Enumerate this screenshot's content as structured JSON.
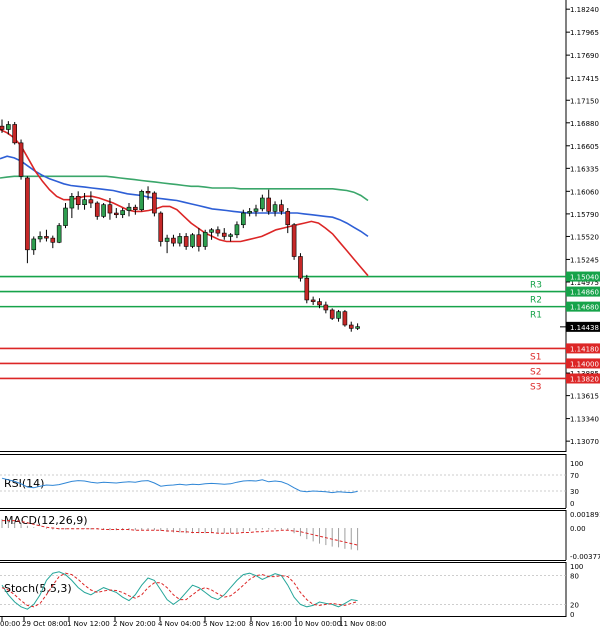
{
  "chart_data": [
    {
      "type": "candlestick",
      "title": "",
      "ylim": [
        1.13,
        1.1829
      ],
      "y_ticks": [
        "1.18240",
        "1.17965",
        "1.17690",
        "1.17415",
        "1.17150",
        "1.16880",
        "1.16605",
        "1.16335",
        "1.16060",
        "1.15790",
        "1.15520",
        "1.15245",
        "1.14975",
        "1.14705",
        "1.14435",
        "1.14160",
        "1.13885",
        "1.13615",
        "1.13340",
        "1.13070"
      ],
      "current_price": "1.14438",
      "candles": [
        [
          1.1684,
          1.1692,
          1.1676,
          1.168
        ],
        [
          1.168,
          1.169,
          1.1674,
          1.1686
        ],
        [
          1.1686,
          1.1689,
          1.1662,
          1.1664
        ],
        [
          1.1664,
          1.1668,
          1.162,
          1.1624
        ],
        [
          1.1622,
          1.1624,
          1.152,
          1.1536
        ],
        [
          1.1536,
          1.1552,
          1.153,
          1.1549
        ],
        [
          1.1549,
          1.1558,
          1.1545,
          1.1552
        ],
        [
          1.1552,
          1.156,
          1.1546,
          1.155
        ],
        [
          1.155,
          1.1553,
          1.1538,
          1.1545
        ],
        [
          1.1545,
          1.1568,
          1.1544,
          1.1565
        ],
        [
          1.1565,
          1.1592,
          1.1562,
          1.1586
        ],
        [
          1.1586,
          1.1604,
          1.1574,
          1.16
        ],
        [
          1.16,
          1.1606,
          1.1584,
          1.159
        ],
        [
          1.159,
          1.1604,
          1.1584,
          1.1596
        ],
        [
          1.1596,
          1.1606,
          1.1586,
          1.1592
        ],
        [
          1.1592,
          1.1594,
          1.1572,
          1.1576
        ],
        [
          1.1576,
          1.1592,
          1.1574,
          1.159
        ],
        [
          1.159,
          1.1598,
          1.1572,
          1.158
        ],
        [
          1.158,
          1.1586,
          1.1574,
          1.1578
        ],
        [
          1.1578,
          1.1586,
          1.1574,
          1.1583
        ],
        [
          1.1583,
          1.1592,
          1.1576,
          1.1587
        ],
        [
          1.1587,
          1.159,
          1.1578,
          1.1584
        ],
        [
          1.1584,
          1.1608,
          1.1582,
          1.1606
        ],
        [
          1.1606,
          1.1612,
          1.1596,
          1.1604
        ],
        [
          1.1604,
          1.1606,
          1.1576,
          1.158
        ],
        [
          1.158,
          1.1582,
          1.154,
          1.1546
        ],
        [
          1.1546,
          1.1554,
          1.1532,
          1.155
        ],
        [
          1.155,
          1.1554,
          1.154,
          1.1544
        ],
        [
          1.1544,
          1.1556,
          1.154,
          1.1552
        ],
        [
          1.1552,
          1.1556,
          1.1536,
          1.154
        ],
        [
          1.154,
          1.1556,
          1.1538,
          1.1554
        ],
        [
          1.1554,
          1.1562,
          1.1534,
          1.154
        ],
        [
          1.154,
          1.156,
          1.1536,
          1.1557
        ],
        [
          1.1557,
          1.1562,
          1.1548,
          1.156
        ],
        [
          1.156,
          1.1564,
          1.1552,
          1.1556
        ],
        [
          1.1556,
          1.1562,
          1.1548,
          1.1552
        ],
        [
          1.1552,
          1.1556,
          1.1546,
          1.1554
        ],
        [
          1.1554,
          1.157,
          1.155,
          1.1566
        ],
        [
          1.1566,
          1.1584,
          1.1562,
          1.158
        ],
        [
          1.158,
          1.1586,
          1.1576,
          1.1582
        ],
        [
          1.1582,
          1.159,
          1.1576,
          1.1585
        ],
        [
          1.1585,
          1.1602,
          1.1582,
          1.1598
        ],
        [
          1.1598,
          1.1608,
          1.1578,
          1.1582
        ],
        [
          1.1582,
          1.1594,
          1.1576,
          1.159
        ],
        [
          1.159,
          1.1596,
          1.1578,
          1.1582
        ],
        [
          1.1582,
          1.1586,
          1.1556,
          1.1566
        ],
        [
          1.1566,
          1.1568,
          1.1524,
          1.1528
        ],
        [
          1.1528,
          1.1532,
          1.1498,
          1.1502
        ],
        [
          1.1502,
          1.1506,
          1.1472,
          1.1476
        ],
        [
          1.1476,
          1.148,
          1.147,
          1.1474
        ],
        [
          1.1474,
          1.1478,
          1.1466,
          1.147
        ],
        [
          1.147,
          1.1474,
          1.146,
          1.1464
        ],
        [
          1.1464,
          1.1466,
          1.1452,
          1.1454
        ],
        [
          1.1454,
          1.1464,
          1.145,
          1.1462
        ],
        [
          1.1462,
          1.1464,
          1.1444,
          1.1446
        ],
        [
          1.1446,
          1.145,
          1.1438,
          1.1442
        ],
        [
          1.1442,
          1.1448,
          1.144,
          1.1444
        ]
      ],
      "ma_fast": [
        1.168,
        1.1676,
        1.167,
        1.166,
        1.1645,
        1.163,
        1.1618,
        1.1608,
        1.16,
        1.1596,
        1.1596,
        1.1598,
        1.16,
        1.16,
        1.1598,
        1.1595,
        1.1592,
        1.1588,
        1.1584,
        1.1582,
        1.1582,
        1.1583,
        1.1585,
        1.1588,
        1.1588,
        1.1584,
        1.1576,
        1.1568,
        1.1562,
        1.1556,
        1.1552,
        1.1548,
        1.1546,
        1.1546,
        1.1546,
        1.1548,
        1.155,
        1.1552,
        1.1556,
        1.156,
        1.1562,
        1.1564,
        1.1566,
        1.1568,
        1.157,
        1.1568,
        1.1562,
        1.1555,
        1.1545,
        1.1535,
        1.1525,
        1.1515,
        1.1505
      ],
      "ma_mid": [
        1.1645,
        1.1648,
        1.1646,
        1.1642,
        1.1636,
        1.163,
        1.1625,
        1.1621,
        1.1618,
        1.1615,
        1.1613,
        1.1612,
        1.1611,
        1.161,
        1.1609,
        1.1608,
        1.1607,
        1.1605,
        1.1603,
        1.1602,
        1.1601,
        1.1599,
        1.1598,
        1.1597,
        1.1596,
        1.1595,
        1.1593,
        1.1591,
        1.1589,
        1.1587,
        1.1585,
        1.1584,
        1.1583,
        1.1582,
        1.1581,
        1.158,
        1.158,
        1.158,
        1.158,
        1.158,
        1.158,
        1.158,
        1.158,
        1.1579,
        1.1578,
        1.1577,
        1.1576,
        1.1575,
        1.1572,
        1.1568,
        1.1563,
        1.1558,
        1.1552
      ],
      "ma_slow": [
        1.1622,
        1.1623,
        1.1624,
        1.1624,
        1.1624,
        1.1624,
        1.1624,
        1.1624,
        1.1624,
        1.1624,
        1.1624,
        1.1624,
        1.1624,
        1.1624,
        1.1624,
        1.1624,
        1.1623,
        1.1622,
        1.1621,
        1.162,
        1.1619,
        1.1618,
        1.1617,
        1.1616,
        1.1615,
        1.1614,
        1.1613,
        1.1612,
        1.1612,
        1.1611,
        1.161,
        1.161,
        1.161,
        1.161,
        1.1609,
        1.1609,
        1.1609,
        1.1609,
        1.1609,
        1.1609,
        1.1609,
        1.1609,
        1.1609,
        1.1609,
        1.1609,
        1.1609,
        1.1609,
        1.1609,
        1.1608,
        1.1607,
        1.1605,
        1.1601,
        1.1595
      ],
      "levels": [
        {
          "label": "R3",
          "value": 1.1504,
          "tag": "1.15040",
          "color": "#16a34a"
        },
        {
          "label": "R2",
          "value": 1.1486,
          "tag": "1.14860",
          "color": "#16a34a"
        },
        {
          "label": "R1",
          "value": 1.1468,
          "tag": "1.14680",
          "color": "#16a34a"
        },
        {
          "label": "S1",
          "value": 1.1418,
          "tag": "1.14180",
          "color": "#dc2626"
        },
        {
          "label": "S2",
          "value": 1.14,
          "tag": "1.14000",
          "color": "#dc2626"
        },
        {
          "label": "S3",
          "value": 1.1382,
          "tag": "1.13820",
          "color": "#dc2626"
        }
      ],
      "x_tick_labels": [
        "00:00",
        "29 Oct 08:00",
        "1 Nov 12:00",
        "2 Nov 20:00",
        "4 Nov 04:00",
        "5 Nov 12:00",
        "8 Nov 16:00",
        "10 Nov 00:00",
        "11 Nov 08:00"
      ]
    },
    {
      "type": "line",
      "title": "RSI(14)",
      "ylim": [
        0,
        100
      ],
      "y_ticks": [
        "100",
        "70",
        "30",
        "0"
      ],
      "values": [
        62,
        58,
        54,
        48,
        40,
        38,
        42,
        45,
        44,
        46,
        50,
        54,
        56,
        55,
        52,
        50,
        52,
        51,
        50,
        52,
        53,
        52,
        55,
        56,
        50,
        42,
        44,
        45,
        47,
        45,
        47,
        46,
        48,
        49,
        48,
        47,
        48,
        52,
        55,
        56,
        55,
        58,
        53,
        55,
        53,
        47,
        38,
        30,
        28,
        30,
        29,
        28,
        26,
        28,
        27,
        26,
        29
      ]
    },
    {
      "type": "bar",
      "title": "MACD(12,26,9)",
      "ylim": [
        -0.003771,
        0.001891
      ],
      "y_ticks": [
        "0.001891",
        "0.00",
        "-0.003771"
      ],
      "values": [
        0.0012,
        0.0011,
        0.001,
        0.0007,
        0.0003,
        0.0001,
        0.0,
        -0.0001,
        -0.0002,
        -0.0002,
        -0.0002,
        -0.0001,
        -0.0001,
        -0.0001,
        -0.0002,
        -0.0002,
        -0.0002,
        -0.0003,
        -0.0003,
        -0.0003,
        -0.0003,
        -0.0003,
        -0.0003,
        -0.0003,
        -0.0003,
        -0.0004,
        -0.0005,
        -0.0006,
        -0.0006,
        -0.0007,
        -0.0007,
        -0.0007,
        -0.0007,
        -0.0007,
        -0.0007,
        -0.0007,
        -0.0007,
        -0.0006,
        -0.0005,
        -0.0004,
        -0.0003,
        -0.0002,
        -0.0002,
        -0.0002,
        -0.0002,
        -0.0003,
        -0.0007,
        -0.0011,
        -0.0015,
        -0.0018,
        -0.0021,
        -0.0023,
        -0.0025,
        -0.0026,
        -0.0028,
        -0.0029,
        -0.003
      ],
      "signal": [
        0.001,
        0.001,
        0.001,
        0.0009,
        0.0007,
        0.0005,
        0.0003,
        0.0001,
        0.0,
        -0.0001,
        -0.0001,
        -0.0001,
        -0.0001,
        -0.0001,
        -0.0001,
        -0.0001,
        -0.0002,
        -0.0002,
        -0.0002,
        -0.0002,
        -0.0002,
        -0.0003,
        -0.0003,
        -0.0003,
        -0.0003,
        -0.0003,
        -0.0004,
        -0.0004,
        -0.0005,
        -0.0005,
        -0.0006,
        -0.0006,
        -0.0006,
        -0.0006,
        -0.0007,
        -0.0007,
        -0.0007,
        -0.0007,
        -0.0006,
        -0.0006,
        -0.0005,
        -0.0005,
        -0.0004,
        -0.0004,
        -0.0003,
        -0.0003,
        -0.0004,
        -0.0005,
        -0.0007,
        -0.0009,
        -0.0011,
        -0.0013,
        -0.0015,
        -0.0017,
        -0.0019,
        -0.0021,
        -0.0023
      ]
    },
    {
      "type": "line",
      "title": "Stoch(5,5,3)",
      "ylim": [
        0,
        100
      ],
      "y_ticks": [
        "100",
        "80",
        "20",
        "0"
      ],
      "series": [
        {
          "values": [
            60,
            40,
            25,
            15,
            10,
            20,
            40,
            70,
            85,
            88,
            82,
            70,
            55,
            45,
            40,
            48,
            55,
            50,
            45,
            35,
            28,
            40,
            60,
            75,
            70,
            50,
            30,
            20,
            30,
            45,
            60,
            55,
            45,
            35,
            30,
            40,
            55,
            70,
            82,
            85,
            80,
            72,
            78,
            84,
            80,
            60,
            35,
            20,
            15,
            18,
            25,
            22,
            20,
            15,
            22,
            30,
            28
          ]
        },
        {
          "values": [
            55,
            50,
            40,
            28,
            18,
            15,
            22,
            40,
            60,
            78,
            85,
            82,
            72,
            60,
            50,
            45,
            48,
            50,
            49,
            45,
            38,
            33,
            40,
            55,
            65,
            65,
            55,
            40,
            30,
            30,
            40,
            50,
            55,
            50,
            42,
            35,
            38,
            48,
            60,
            72,
            80,
            82,
            78,
            78,
            80,
            78,
            65,
            45,
            30,
            20,
            18,
            20,
            22,
            20,
            18,
            22,
            26
          ]
        }
      ]
    }
  ]
}
